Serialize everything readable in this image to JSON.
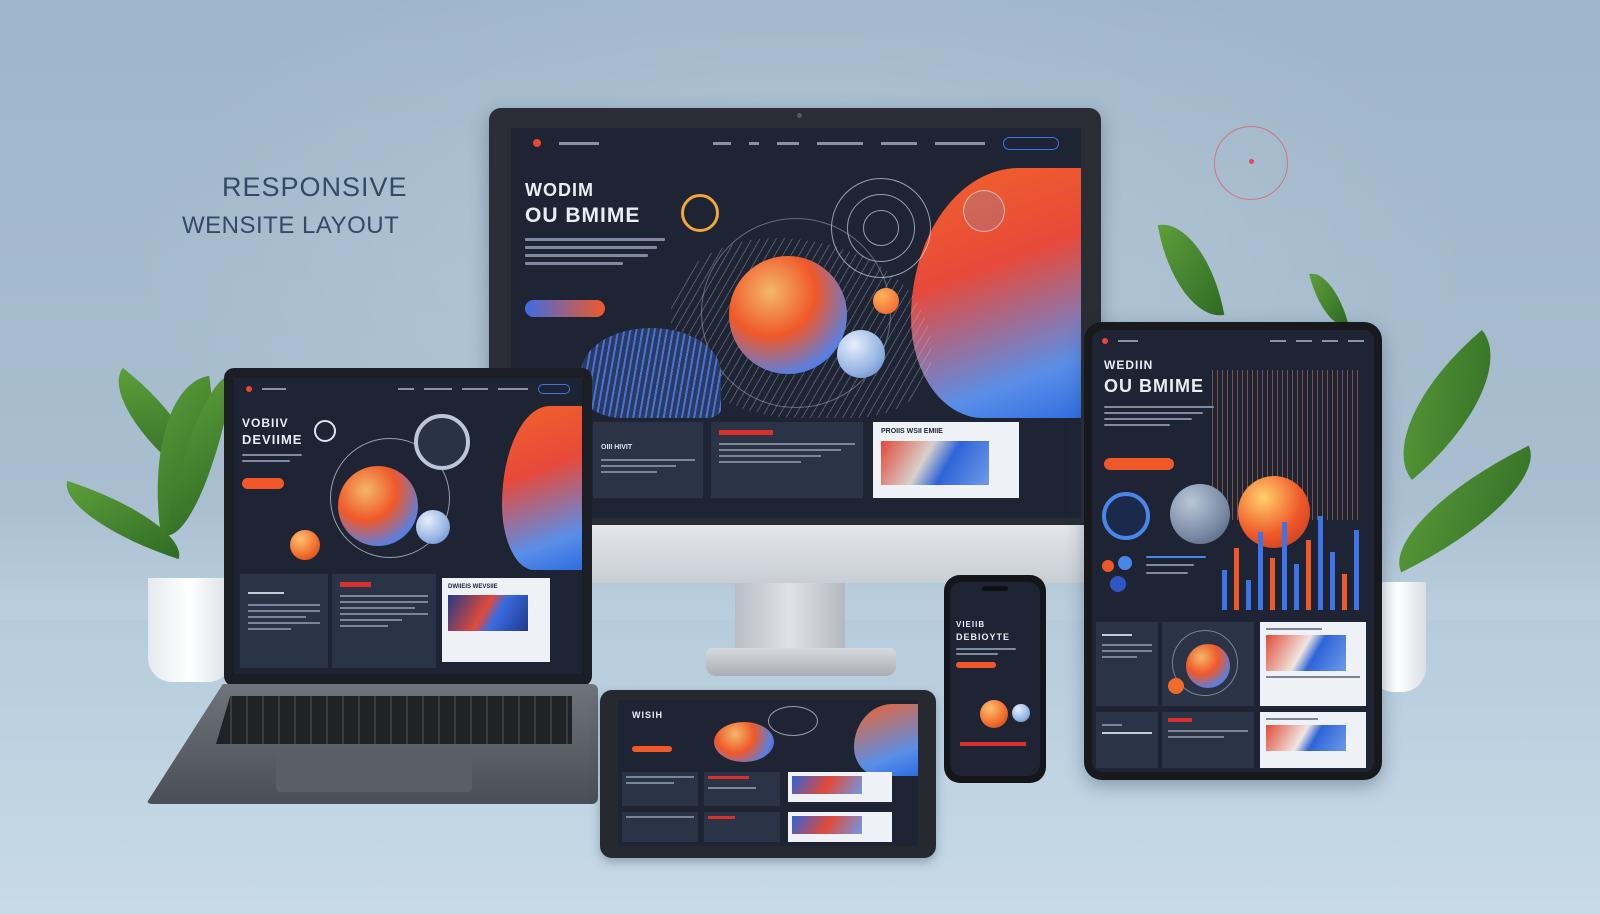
{
  "headline": {
    "line1": "RESPONSIVE",
    "line2": "WENSITE LAYOUT"
  },
  "monitor_screen": {
    "hero_title_line1": "WODIM",
    "hero_title_line2": "OU BMIME",
    "card1_title": "OIII HIVIT",
    "card3_title": "PROIIS WSII EMIIE"
  },
  "laptop_screen": {
    "hero_title_line1": "VOBIIV",
    "hero_title_line2": "DEVIIME",
    "card3_title": "DWIIEIS WEVSIIE"
  },
  "tablet_right_screen": {
    "hero_title_line1": "WEDIIN",
    "hero_title_line2": "OU BMIME"
  },
  "phone_screen": {
    "hero_title_line1": "VIEIIB",
    "hero_title_line2": "DEBIOYTE"
  },
  "tablet_flat_screen": {
    "hero_title": "WISIH"
  },
  "colors": {
    "accent_orange": "#f0582a",
    "accent_blue": "#3f6be0",
    "screen_bg": "#1e2433",
    "background": "#a9bfd0"
  }
}
